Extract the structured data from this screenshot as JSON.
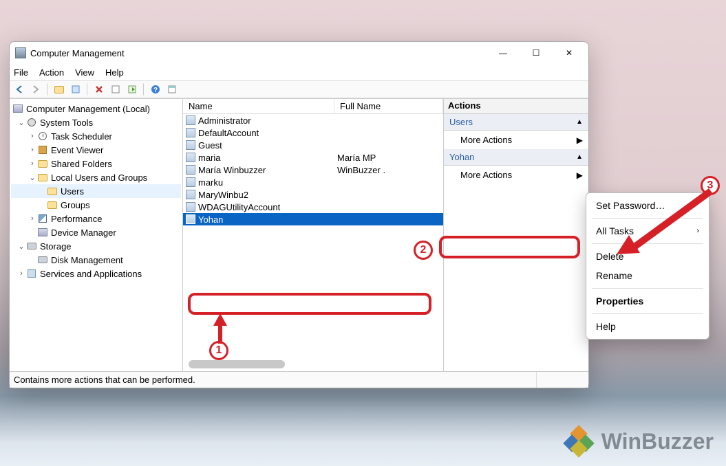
{
  "window": {
    "title": "Computer Management",
    "menu": {
      "file": "File",
      "action": "Action",
      "view": "View",
      "help": "Help"
    },
    "statusbar": "Contains more actions that can be performed."
  },
  "tree": {
    "root": "Computer Management (Local)",
    "system_tools": "System Tools",
    "task_scheduler": "Task Scheduler",
    "event_viewer": "Event Viewer",
    "shared_folders": "Shared Folders",
    "local_users": "Local Users and Groups",
    "users": "Users",
    "groups": "Groups",
    "performance": "Performance",
    "device_manager": "Device Manager",
    "storage": "Storage",
    "disk_management": "Disk Management",
    "services": "Services and Applications"
  },
  "list": {
    "cols": {
      "name": "Name",
      "fullname": "Full Name"
    },
    "rows": [
      {
        "name": "Administrator",
        "full": ""
      },
      {
        "name": "DefaultAccount",
        "full": ""
      },
      {
        "name": "Guest",
        "full": ""
      },
      {
        "name": "maria",
        "full": "María MP"
      },
      {
        "name": "María Winbuzzer",
        "full": "WinBuzzer ."
      },
      {
        "name": "marku",
        "full": ""
      },
      {
        "name": "MaryWinbu2",
        "full": ""
      },
      {
        "name": "WDAGUtilityAccount",
        "full": ""
      },
      {
        "name": "Yohan",
        "full": ""
      }
    ]
  },
  "actions": {
    "title": "Actions",
    "section1": "Users",
    "more1": "More Actions",
    "section2": "Yohan",
    "more2": "More Actions"
  },
  "ctx": {
    "set_password": "Set Password…",
    "all_tasks": "All Tasks",
    "delete": "Delete",
    "rename": "Rename",
    "properties": "Properties",
    "help": "Help"
  },
  "callouts": {
    "1": "1",
    "2": "2",
    "3": "3"
  },
  "watermark": "WinBuzzer"
}
